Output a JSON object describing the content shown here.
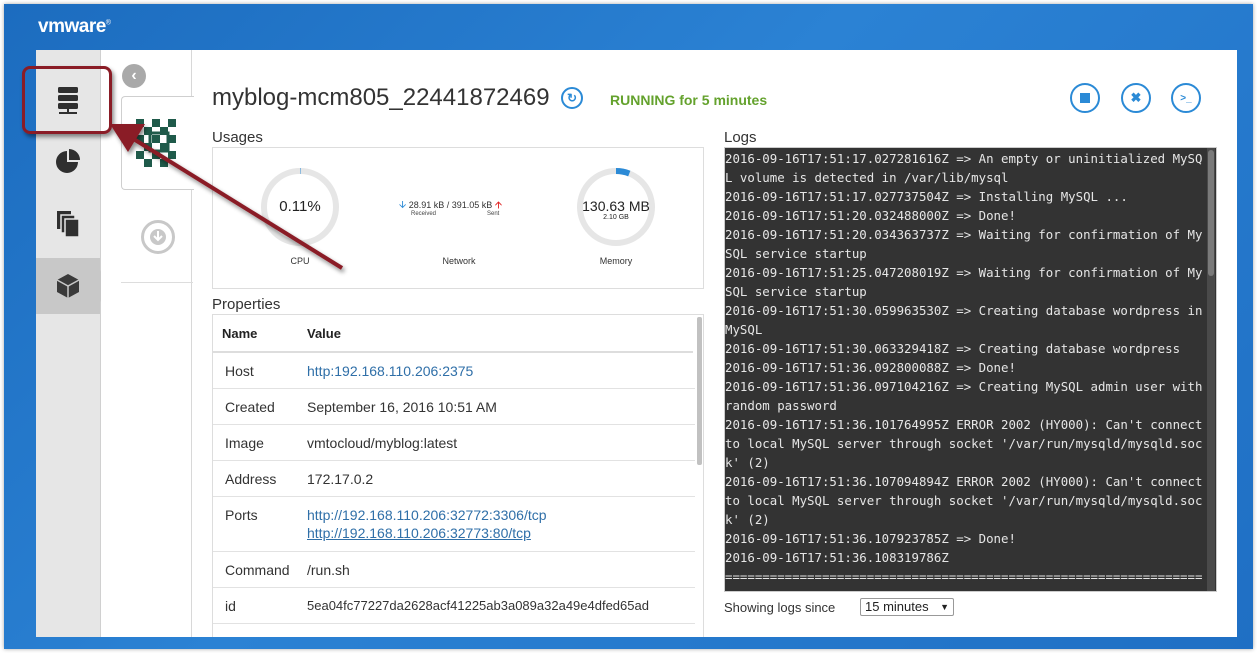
{
  "brand": {
    "logo_text": "vm",
    "logo_text2": "ware",
    "logo_mark": "®"
  },
  "container": {
    "name": "myblog-mcm805_22441872469",
    "status": "RUNNING for 5 minutes",
    "status_color": "#64a22d"
  },
  "usages": {
    "title": "Usages",
    "cpu": {
      "value": "0.11%",
      "label": "CPU",
      "fraction": 0.0011
    },
    "network": {
      "received": "28.91 kB",
      "sent": "391.05 kB",
      "separator": "/",
      "received_label": "Received",
      "sent_label": "Sent",
      "label": "Network"
    },
    "memory": {
      "value": "130.63 MB",
      "limit": "2.10 GB",
      "label": "Memory",
      "fraction": 0.06
    }
  },
  "properties": {
    "title": "Properties",
    "col_name": "Name",
    "col_value": "Value",
    "rows": {
      "host": {
        "k": "Host",
        "v": "http:192.168.110.206:2375"
      },
      "created": {
        "k": "Created",
        "v": "September 16, 2016 10:51 AM"
      },
      "image": {
        "k": "Image",
        "v": "vmtocloud/myblog:latest"
      },
      "address": {
        "k": "Address",
        "v": "172.17.0.2"
      },
      "ports": {
        "k": "Ports",
        "v1": "http://192.168.110.206:32772:3306/tcp",
        "v2": "http://192.168.110.206:32773:80/tcp"
      },
      "command": {
        "k": "Command",
        "v": "/run.sh"
      },
      "id": {
        "k": "id",
        "v": "5ea04fc77227da2628acf41225ab3a089a32a49e4dfed65ad"
      }
    }
  },
  "logs": {
    "title": "Logs",
    "text": "2016-09-16T17:51:17.027281616Z => An empty or uninitialized MySQL volume is detected in /var/lib/mysql\n2016-09-16T17:51:17.027737504Z => Installing MySQL ...\n2016-09-16T17:51:20.032488000Z => Done!\n2016-09-16T17:51:20.034363737Z => Waiting for confirmation of MySQL service startup\n2016-09-16T17:51:25.047208019Z => Waiting for confirmation of MySQL service startup\n2016-09-16T17:51:30.059963530Z => Creating database wordpress in MySQL\n2016-09-16T17:51:30.063329418Z => Creating database wordpress\n2016-09-16T17:51:36.092800088Z => Done!\n2016-09-16T17:51:36.097104216Z => Creating MySQL admin user with random password\n2016-09-16T17:51:36.101764995Z ERROR 2002 (HY000): Can't connect to local MySQL server through socket '/var/run/mysqld/mysqld.sock' (2)\n2016-09-16T17:51:36.107094894Z ERROR 2002 (HY000): Can't connect to local MySQL server through socket '/var/run/mysqld/mysqld.sock' (2)\n2016-09-16T17:51:36.107923785Z => Done!\n2016-09-16T17:51:36.108319786Z\n========================================================================",
    "since_label": "Showing logs since",
    "since_value": "15 minutes"
  },
  "colors": {
    "accent": "#2b8ad6",
    "annotation": "#8a1c26",
    "log_bg": "#333333"
  }
}
